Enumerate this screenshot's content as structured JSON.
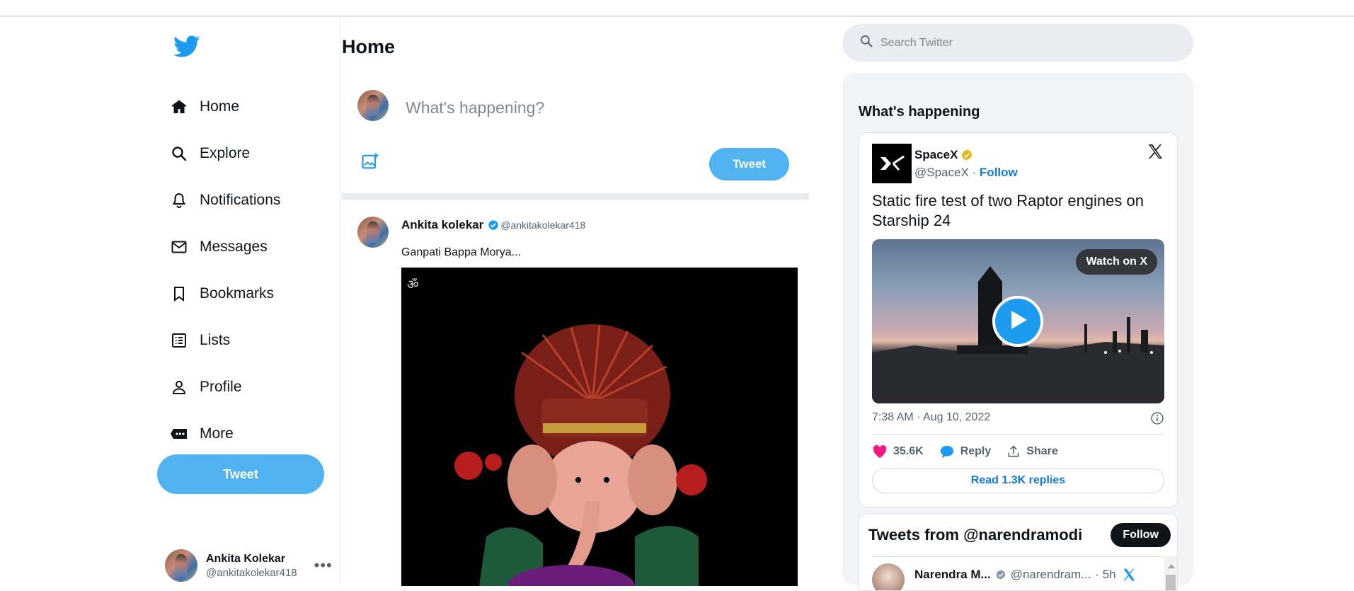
{
  "sidebar": {
    "items": [
      {
        "label": "Home",
        "icon": "home-icon"
      },
      {
        "label": "Explore",
        "icon": "search-icon"
      },
      {
        "label": "Notifications",
        "icon": "bell-icon"
      },
      {
        "label": "Messages",
        "icon": "mail-icon"
      },
      {
        "label": "Bookmarks",
        "icon": "bookmark-icon"
      },
      {
        "label": "Lists",
        "icon": "list-icon"
      },
      {
        "label": "Profile",
        "icon": "person-icon"
      },
      {
        "label": "More",
        "icon": "more-icon"
      }
    ],
    "tweet_button": "Tweet",
    "account": {
      "name": "Ankita Kolekar",
      "handle": "@ankitakolekar418"
    }
  },
  "main": {
    "title": "Home",
    "compose": {
      "placeholder": "What's happening?",
      "tweet_button": "Tweet"
    },
    "post": {
      "author_name": "Ankita kolekar",
      "author_handle": "@ankitakolekar418",
      "text": "Ganpati Bappa Morya..."
    }
  },
  "right": {
    "search_placeholder": "Search Twitter",
    "trends_title": "What's happening",
    "embed": {
      "name": "SpaceX",
      "handle": "@SpaceX",
      "dot": " · ",
      "follow": "Follow",
      "text": "Static fire test of two Raptor engines on Starship 24",
      "watch": "Watch on X",
      "time": "7:38 AM · Aug 10, 2022",
      "likes": "35.6K",
      "reply": "Reply",
      "share": "Share",
      "read_replies": "Read 1.3K replies"
    },
    "timeline": {
      "title": "Tweets from @narendramodi",
      "follow": "Follow",
      "row_name": "Narendra M...",
      "row_handle": "@narendram...",
      "row_time": "· 5h"
    }
  },
  "colors": {
    "accent": "#50b3f0",
    "link": "#1877d6",
    "verified": "#1d9bf0",
    "gold": "#e2b719",
    "like": "#f91880"
  }
}
